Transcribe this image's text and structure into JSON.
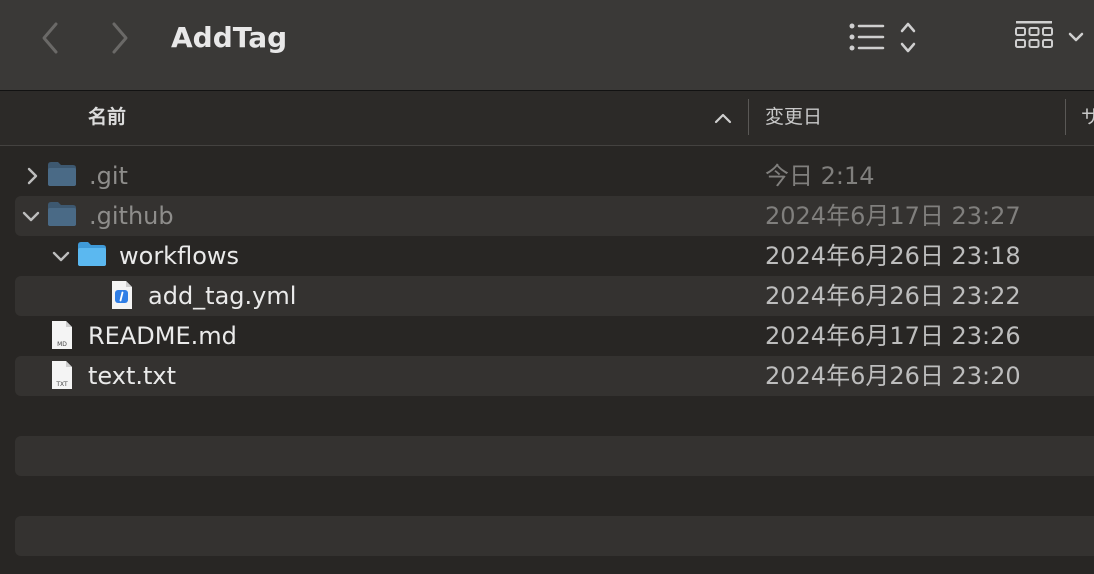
{
  "window": {
    "title": "AddTag"
  },
  "toolbar": {
    "back_icon": "chevron-left-icon",
    "forward_icon": "chevron-right-icon",
    "view_icon": "list-view-icon",
    "group_icon": "group-grid-icon"
  },
  "columns": {
    "name": "名前",
    "date": "変更日",
    "size": "サ"
  },
  "files": [
    {
      "name": ".git",
      "date": "今日 2:14",
      "type": "folder",
      "expanded": false,
      "depth": 0,
      "dim": true
    },
    {
      "name": ".github",
      "date": "2024年6月17日 23:27",
      "type": "folder",
      "expanded": true,
      "depth": 0,
      "dim": true
    },
    {
      "name": "workflows",
      "date": "2024年6月26日 23:18",
      "type": "folder",
      "expanded": true,
      "depth": 1,
      "dim": false
    },
    {
      "name": "add_tag.yml",
      "date": "2024年6月26日 23:22",
      "type": "yml-file",
      "depth": 2,
      "dim": false
    },
    {
      "name": "README.md",
      "date": "2024年6月17日 23:26",
      "type": "md-file",
      "badge": "MD",
      "depth": 0,
      "dim": false
    },
    {
      "name": "text.txt",
      "date": "2024年6月26日 23:20",
      "type": "txt-file",
      "badge": "TXT",
      "depth": 0,
      "dim": false
    }
  ],
  "colors": {
    "toolbar_bg": "#3a3937",
    "list_bg": "#282624",
    "alt_row": "#343230",
    "folder_dim": "#4a6a86",
    "folder_bright": "#5bb8f0"
  }
}
